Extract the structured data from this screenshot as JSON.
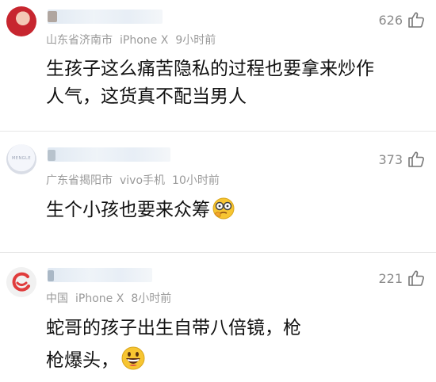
{
  "comments": [
    {
      "location": "山东省济南市",
      "device": "iPhone X",
      "time": "9小时前",
      "likes": "626",
      "text_lines": [
        "生孩子这么痛苦隐私的过程也要拿来炒作",
        "人气，这货真不配当男人"
      ]
    },
    {
      "location": "广东省揭阳市",
      "device": "vivo手机",
      "time": "10小时前",
      "likes": "373",
      "text_lines": [
        "生个小孩也要来众筹"
      ],
      "emoji": "thinking-glasses-emoji"
    },
    {
      "location": "中国",
      "device": "iPhone X",
      "time": "8小时前",
      "likes": "221",
      "text_lines": [
        "蛇哥的孩子出生自带八倍镜，枪",
        "枪爆头，"
      ],
      "emoji": "grinning-emoji"
    }
  ],
  "icons": {
    "like": "thumbs-up-icon"
  },
  "colors": {
    "meta": "#9a9a9a",
    "text": "#111111",
    "divider": "#e6e6e6",
    "emoji_yellow": "#f7c531"
  }
}
